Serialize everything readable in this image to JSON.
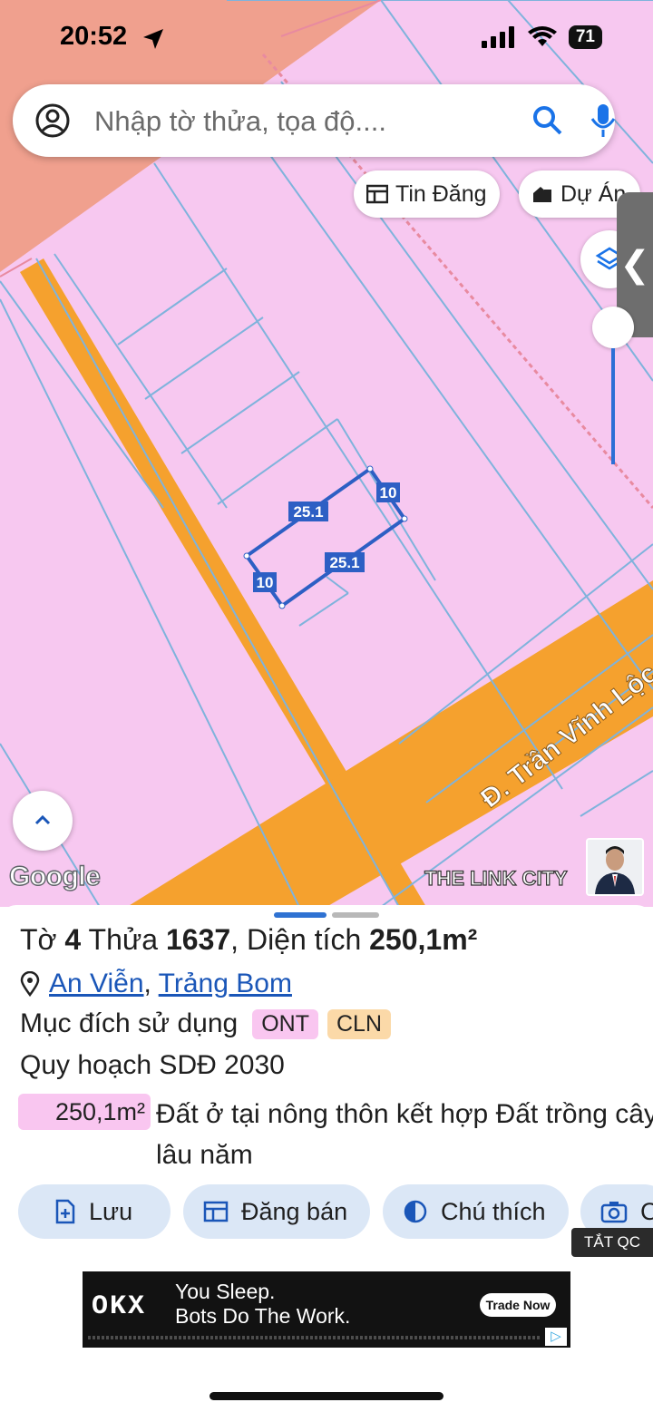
{
  "status_bar": {
    "time": "20:52",
    "battery": "71"
  },
  "search": {
    "placeholder": "Nhập tờ thửa, tọa độ...."
  },
  "chips": {
    "listings": "Tin Đăng",
    "projects": "Dự Án"
  },
  "map": {
    "measurements": {
      "top": "25.1",
      "bottom": "25.1",
      "left": "10",
      "right": "10"
    },
    "street_label": "Đ. Trần Vĩnh Lộc",
    "google_logo": "Google",
    "watermark": "THE LINK CITY",
    "colors": {
      "residential": "#f7c8f0",
      "road": "#f5a12e",
      "outside": "#f0a08e",
      "parcel_line": "#7fb3dc",
      "highlight": "#2d5fc4"
    }
  },
  "parcel": {
    "title_prefix": "Tờ",
    "sheet_no": "4",
    "parcel_label": "Thửa",
    "parcel_no": "1637",
    "area_label": ", Diện tích",
    "area": "250,1m²",
    "commune": "An Viễn",
    "separator": ",",
    "district": "Trảng Bom",
    "usage_label": "Mục đích sử dụng",
    "usage_codes": [
      "ONT",
      "CLN"
    ],
    "usage_colors": [
      "#f9c6f0",
      "#fbd9a8"
    ],
    "plan_label": "Quy hoạch SDĐ 2030",
    "plan_area": "250,1m²",
    "plan_land_type": "Đất ở tại nông thôn kết hợp Đất trồng cây lâu năm"
  },
  "actions": {
    "save": "Lưu",
    "post_sale": "Đăng bán",
    "legend": "Chú thích",
    "capture": "C"
  },
  "ad": {
    "close_label": "TẮT QC",
    "brand": "OKX",
    "line1": "You Sleep.",
    "line2": "Bots Do The Work.",
    "cta": "Trade Now"
  }
}
